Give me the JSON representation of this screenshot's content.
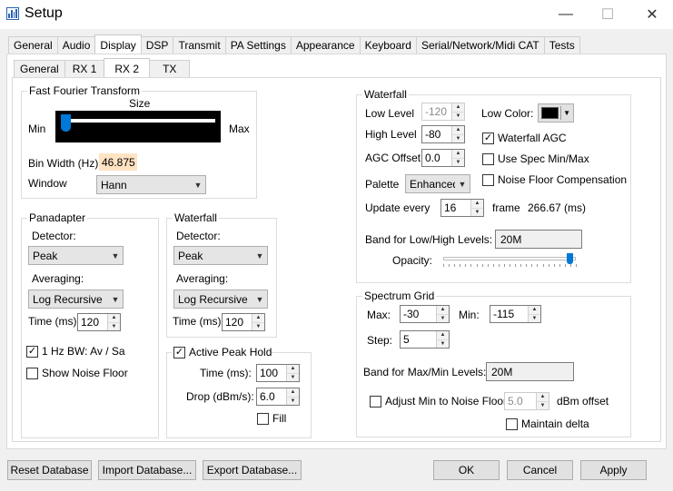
{
  "window": {
    "title": "Setup",
    "minimize_label": "—",
    "maximize_label": "☐",
    "close_label": "✕"
  },
  "main_tabs": [
    "General",
    "Audio",
    "Display",
    "DSP",
    "Transmit",
    "PA Settings",
    "Appearance",
    "Keyboard",
    "Serial/Network/Midi CAT",
    "Tests"
  ],
  "sub_tabs": [
    "General",
    "RX 1",
    "RX 2",
    "TX"
  ],
  "fft": {
    "title": "Fast Fourier Transform",
    "size_label": "Size",
    "min_label": "Min",
    "max_label": "Max",
    "size_level": 0.0,
    "bin_width_label": "Bin Width (Hz)",
    "bin_width_value": "46.875",
    "window_label": "Window",
    "window_value": "Hann"
  },
  "panadapter": {
    "title": "Panadapter",
    "detector_label": "Detector:",
    "detector_value": "Peak",
    "averaging_label": "Averaging:",
    "averaging_value": "Log Recursive",
    "time_label": "Time (ms):",
    "time_value": "120",
    "bw_label": "1 Hz BW: Av / Sa",
    "bw_checked": "✓",
    "noise_floor_label": "Show Noise Floor"
  },
  "waterfall_left": {
    "title": "Waterfall",
    "detector_label": "Detector:",
    "detector_value": "Peak",
    "averaging_label": "Averaging:",
    "averaging_value": "Log Recursive",
    "time_label": "Time (ms):",
    "time_value": "120"
  },
  "peak_hold": {
    "title": "Active Peak Hold",
    "checked": "✓",
    "time_label": "Time (ms):",
    "time_value": "100",
    "drop_label": "Drop (dBm/s):",
    "drop_value": "6.0",
    "fill_label": "Fill"
  },
  "waterfall_right": {
    "title": "Waterfall",
    "low_level_label": "Low Level",
    "low_level_value": "-120",
    "high_level_label": "High Level",
    "high_level_value": "-80",
    "agc_offset_label": "AGC Offset",
    "agc_offset_value": "0.0",
    "palette_label": "Palette",
    "palette_value": "Enhanced",
    "update_label": "Update every",
    "update_value": "16",
    "frame_label": "frame",
    "frame_ms": "266.67 (ms)",
    "low_color_label": "Low Color:",
    "low_color": "#000000",
    "waterfall_agc_label": "Waterfall AGC",
    "waterfall_agc_checked": "✓",
    "use_spec_label": "Use Spec Min/Max",
    "noise_comp_label": "Noise Floor Compensation",
    "band_label": "Band for Low/High Levels:",
    "band_value": "20M",
    "opacity_label": "Opacity:",
    "opacity_level": 0.98
  },
  "spectrum_grid": {
    "title": "Spectrum Grid",
    "max_label": "Max:",
    "max_value": "-30",
    "min_label": "Min:",
    "min_value": "-115",
    "step_label": "Step:",
    "step_value": "5",
    "band_label": "Band for Max/Min Levels:",
    "band_value": "20M",
    "adjust_label": "Adjust Min to Noise Floor",
    "adjust_value": "5.0",
    "dbm_offset_label": "dBm offset",
    "maintain_delta_label": "Maintain delta"
  },
  "footer": {
    "reset_label": "Reset Database",
    "import_label": "Import Database...",
    "export_label": "Export Database...",
    "ok_label": "OK",
    "cancel_label": "Cancel",
    "apply_label": "Apply"
  },
  "colors": {
    "accent": "#0078d7",
    "bin_width_bg": "#ffe3c2",
    "fft_slider_bg": "#000000"
  }
}
